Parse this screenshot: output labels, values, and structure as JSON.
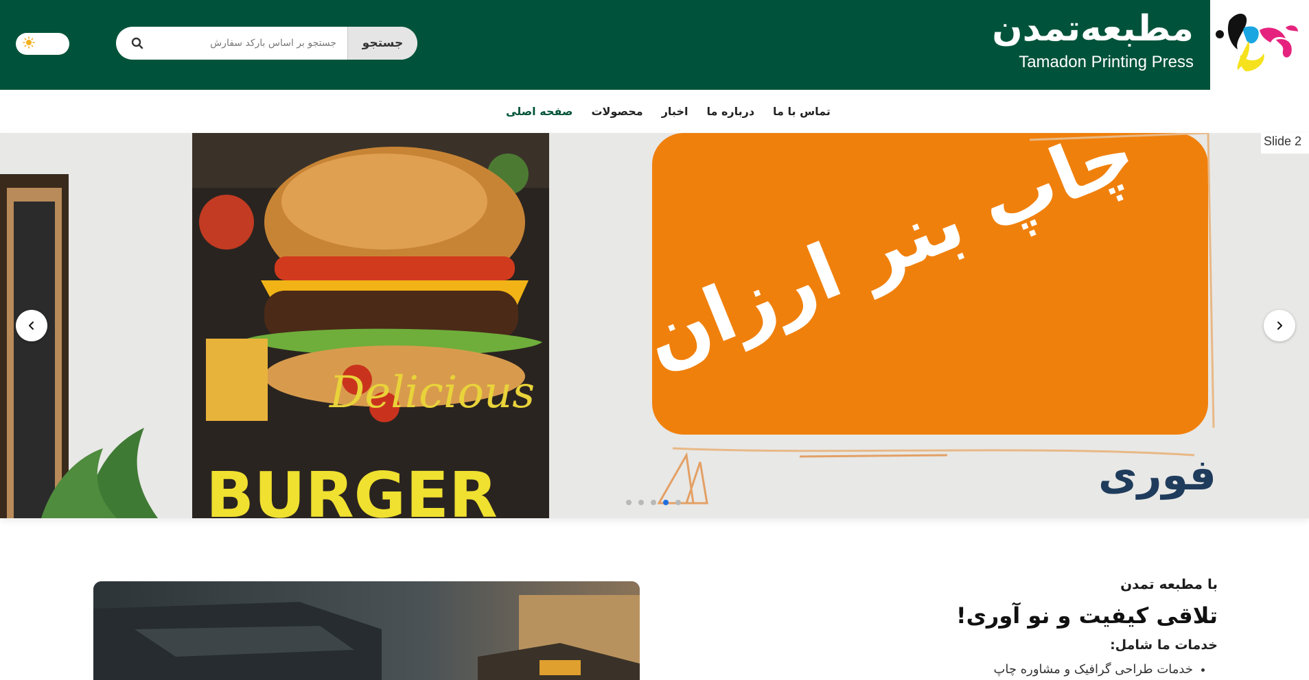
{
  "header": {
    "brand_name_fa": "مطبعه‌تمدن",
    "brand_name_en": "Tamadon Printing Press",
    "logo_icon": "tamadon-logo-icon",
    "colors": {
      "primary": "#00533a",
      "header_bg": "#00533a"
    }
  },
  "search": {
    "button_label": "جستجو",
    "placeholder": "جستجو بر اساس بارکد سفارش",
    "icon": "search-icon"
  },
  "theme_toggle": {
    "light_icon": "sun-icon",
    "dark_icon": "moon-icon"
  },
  "nav": {
    "items": [
      {
        "label": "صفحه اصلی",
        "active": true
      },
      {
        "label": "محصولات",
        "active": false
      },
      {
        "label": "اخبار",
        "active": false
      },
      {
        "label": "درباره ما",
        "active": false
      },
      {
        "label": "تماس با ما",
        "active": false
      }
    ]
  },
  "slider": {
    "broken_image_alt": "Slide 2",
    "slide_text_main": "چاپ بنر ارزان",
    "slide_text_secondary": "فوری",
    "poster_script": "Delicious",
    "poster_title": "BURGER",
    "dots_total": 5,
    "active_dot": 4
  },
  "about": {
    "kicker": "با مطبعه تمدن",
    "title": "تلاقی کیفیت و نو آوری!",
    "subtitle": "خدمات ما شامل:",
    "items": [
      "خدمات طراحی گرافیک و مشاوره چاپ"
    ]
  }
}
